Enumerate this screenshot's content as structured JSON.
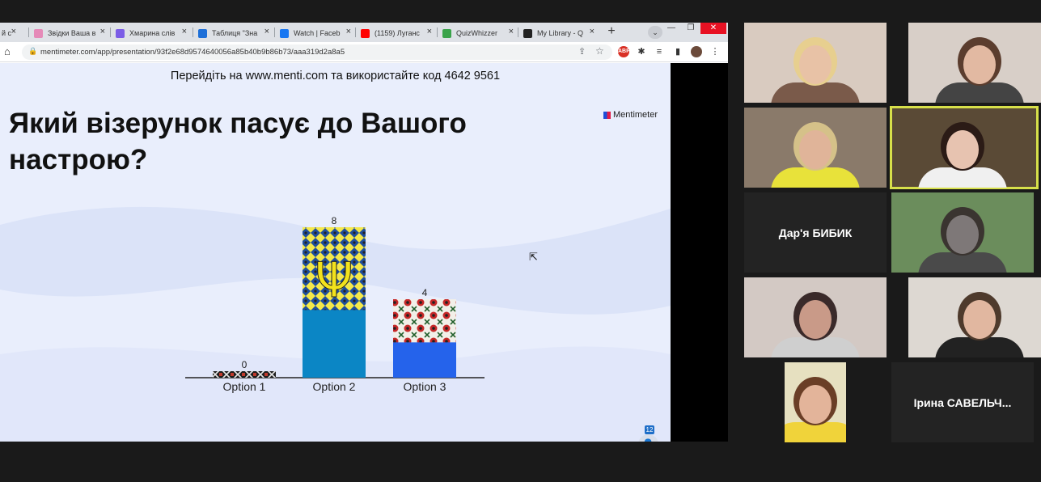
{
  "browser": {
    "tabs": [
      {
        "label": "й с",
        "icon": "ic",
        "color": "#999999"
      },
      {
        "label": "Звідки Ваша в",
        "icon": "pink-shirt-icon",
        "color": "#e58ab8"
      },
      {
        "label": "Хмарина слів",
        "icon": "chart-icon",
        "color": "#7b5ce6"
      },
      {
        "label": "Таблиця \"Зна",
        "icon": "ukraine-flag-icon",
        "color": "#1d6fd8"
      },
      {
        "label": "Watch | Faceb",
        "icon": "facebook-icon",
        "color": "#1877f2"
      },
      {
        "label": "(1159) Луганс",
        "icon": "youtube-icon",
        "color": "#ff0000"
      },
      {
        "label": "QuizWhizzer",
        "icon": "quizwhizzer-icon",
        "color": "#3aa34a"
      },
      {
        "label": "My Library - Q",
        "icon": "quizizz-icon",
        "color": "#222222"
      }
    ],
    "url": "mentimeter.com/app/presentation/93f2e68d9574640056a85b40b9b86b73/aaa319d2a8a5",
    "ext_badge": "ABP"
  },
  "slide": {
    "join_text": "Перейдіть на www.menti.com та використайте код 4642 9561",
    "question": "Який візерунок пасує до Вашого настрою?",
    "brand": "Mentimeter",
    "responses_count": "12"
  },
  "chart_data": {
    "type": "bar",
    "categories": [
      "Option 1",
      "Option 2",
      "Option 3"
    ],
    "values": [
      0,
      8,
      4
    ],
    "title": "",
    "xlabel": "",
    "ylabel": "",
    "ylim": [
      0,
      8
    ],
    "colors": [
      "#1f1f1f",
      "#0b86c5",
      "#2563eb"
    ],
    "grid": false
  },
  "participants": [
    {
      "name": "",
      "video": true,
      "bg": "#d9cbc0",
      "face": "#e8c2a6",
      "hair": "#e7cf8f",
      "shirt": "#7a5a4a"
    },
    {
      "name": "",
      "video": true,
      "bg": "#d8cfc8",
      "face": "#e2b9a2",
      "hair": "#5b3d2e",
      "shirt": "#444444"
    },
    {
      "name": "",
      "video": true,
      "bg": "#8a7a6a",
      "face": "#e0b499",
      "hair": "#d5c189",
      "shirt": "#e8e23a"
    },
    {
      "name": "",
      "video": true,
      "bg": "#5a4a36",
      "face": "#e7c3b0",
      "hair": "#2b1b16",
      "shirt": "#f0f0f0",
      "active": true
    },
    {
      "name": "Дар'я БИБИК",
      "video": false
    },
    {
      "name": "",
      "video": true,
      "bg": "#6b8d5c",
      "face": "#7e7878",
      "hair": "#3a3430",
      "shirt": "#4a4a4a"
    },
    {
      "name": "",
      "video": true,
      "bg": "#d3c9c4",
      "face": "#c99a88",
      "hair": "#3a2a2a",
      "shirt": "#cfcfcf"
    },
    {
      "name": "",
      "video": true,
      "bg": "#ddd8d2",
      "face": "#e1b7a0",
      "hair": "#4e3a2c",
      "shirt": "#222222"
    },
    {
      "name": "",
      "video": true,
      "bg": "#e6e0c0",
      "face": "#e3b49a",
      "hair": "#6a3e26",
      "shirt": "#f0d33a"
    },
    {
      "name": "Ірина  САВЕЛЬЧ...",
      "video": false
    }
  ]
}
